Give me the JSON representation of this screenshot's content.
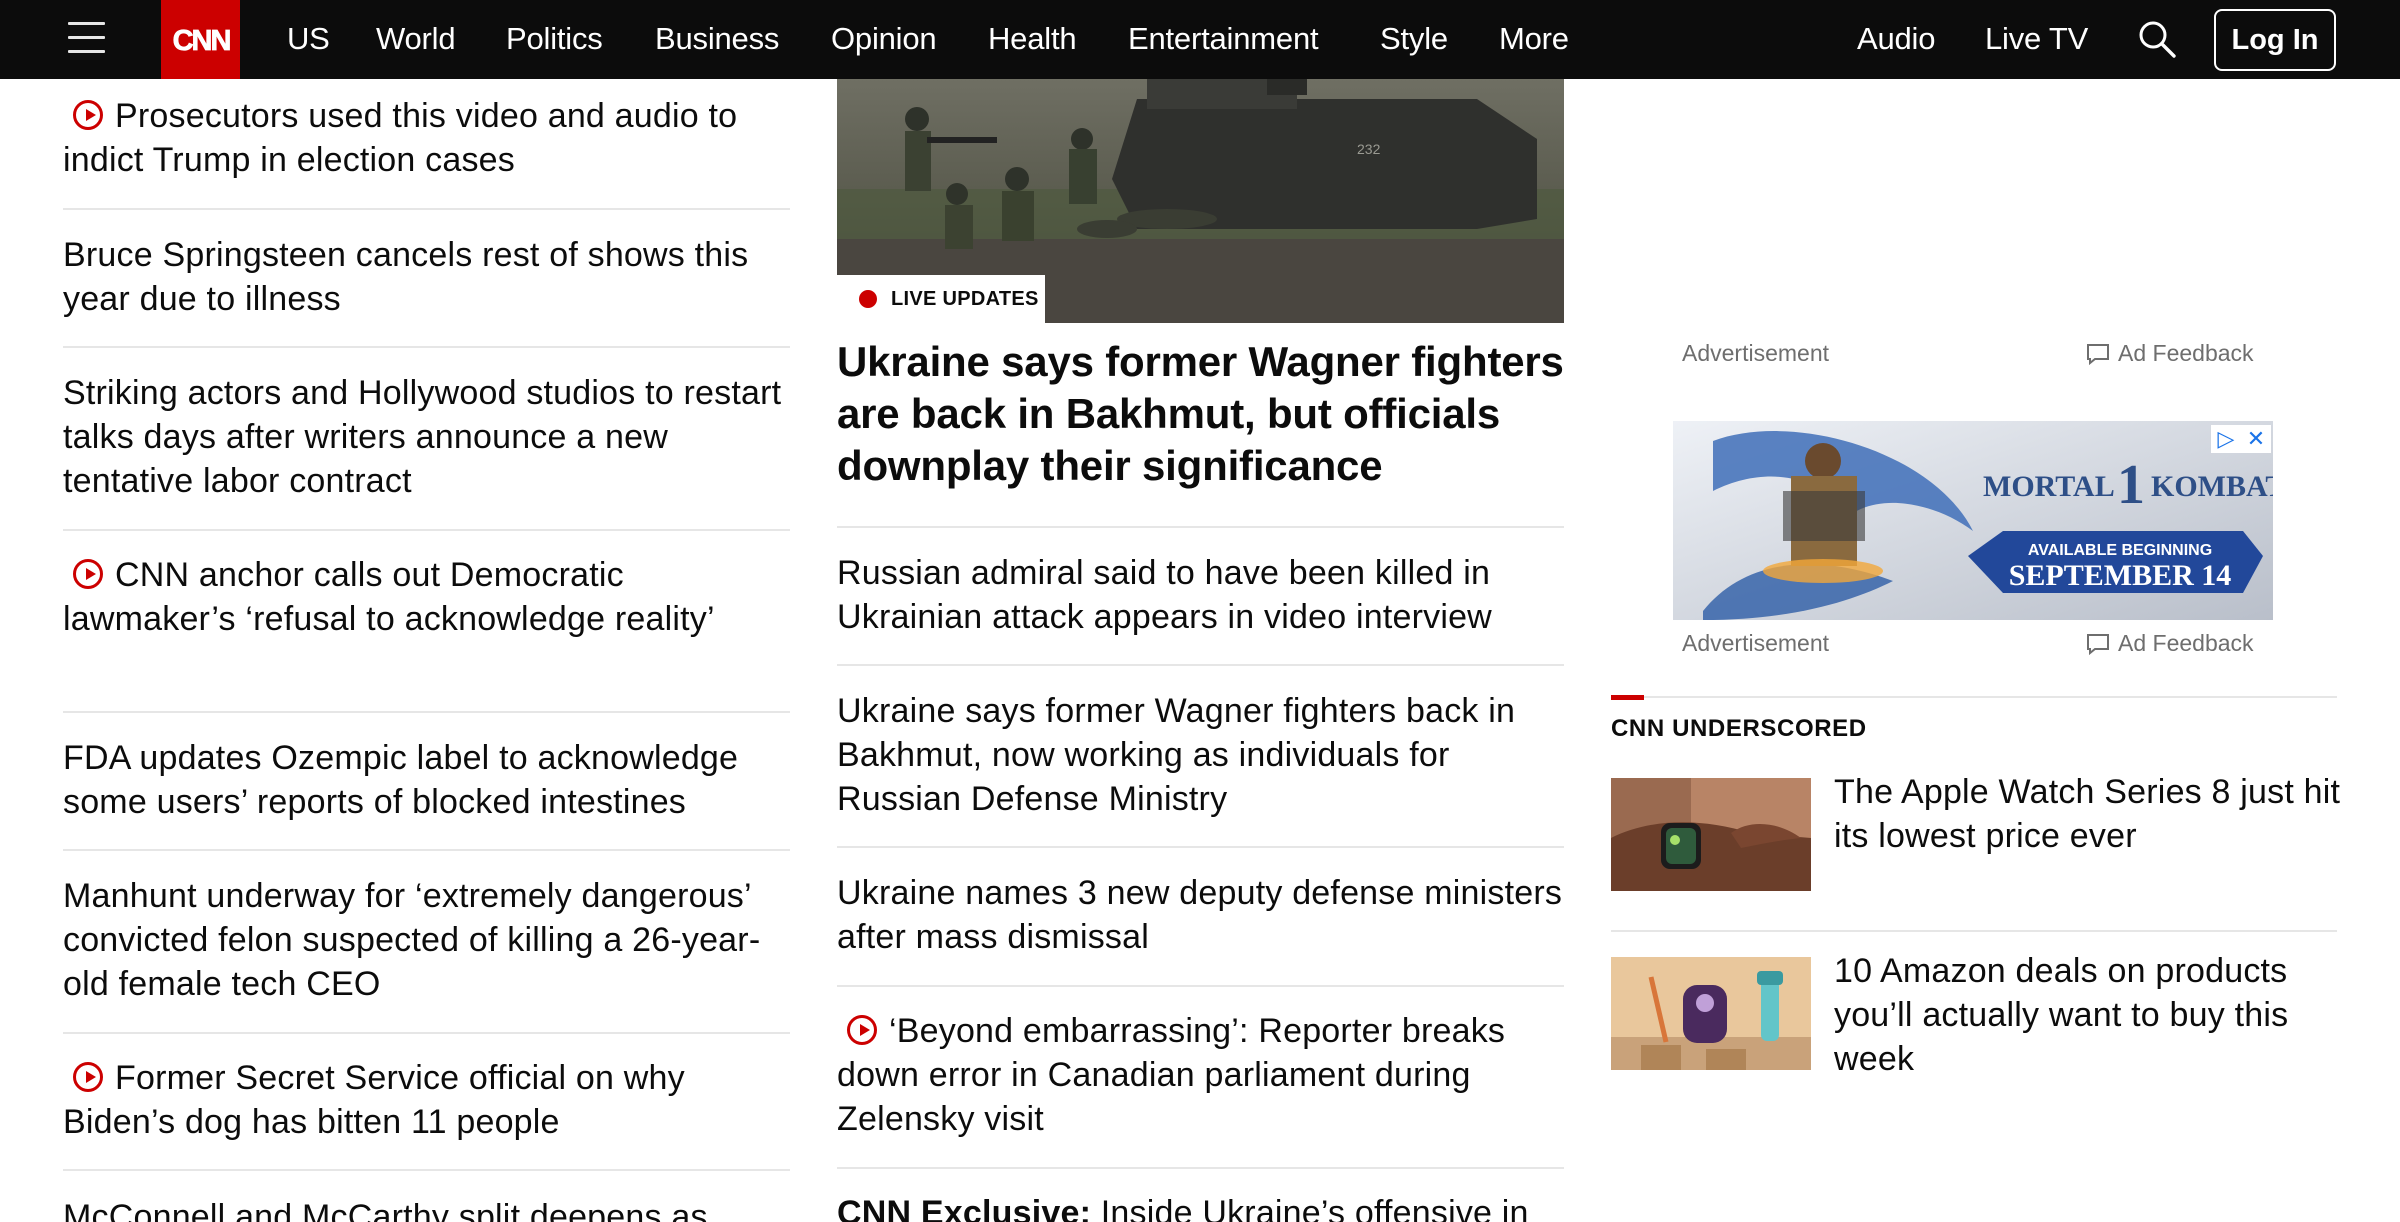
{
  "header": {
    "logo": "CNN",
    "nav": [
      "US",
      "World",
      "Politics",
      "Business",
      "Opinion",
      "Health",
      "Entertainment",
      "Style",
      "More"
    ],
    "right": {
      "audio": "Audio",
      "live_tv": "Live TV",
      "login": "Log In"
    },
    "colors": {
      "bar": "#0c0c0c",
      "brand": "#cc0000"
    }
  },
  "left_stories": [
    {
      "text": "Prosecutors used this video and audio to indict Trump in election cases",
      "video": true
    },
    {
      "text": "Bruce Springsteen cancels rest of shows this year due to illness",
      "video": false
    },
    {
      "text": "Striking actors and Hollywood studios to restart talks days after writers announce a new tentative labor contract",
      "video": false
    },
    {
      "text": "CNN anchor calls out Democratic lawmaker’s ‘refusal to acknowledge reality’",
      "video": true
    },
    {
      "text": "FDA updates Ozempic label to acknowledge some users’ reports of blocked intestines",
      "video": false
    },
    {
      "text": "Manhunt underway for ‘extremely dangerous’ convicted felon suspected of killing a 26-year-old female tech CEO",
      "video": false
    },
    {
      "text": "Former Secret Service official on why Biden’s dog has bitten 11 people",
      "video": true
    },
    {
      "text": "McConnell and McCarthy split deepens as",
      "video": false
    }
  ],
  "main": {
    "badge": "LIVE UPDATES",
    "hero_vehicle_marking": "232",
    "headline": "Ukraine says former Wagner fighters are back in Bakhmut, but officials downplay their significance",
    "stories": [
      {
        "text": "Russian admiral said to have been killed in Ukrainian attack appears in video interview",
        "video": false
      },
      {
        "text": "Ukraine says former Wagner fighters back in Bakhmut, now working as individuals for Russian Defense Ministry",
        "video": false
      },
      {
        "text": "Ukraine names 3 new deputy defense ministers after mass dismissal",
        "video": false
      },
      {
        "text": "‘Beyond embarrassing’: Reporter breaks down error in Canadian parliament during Zelensky visit",
        "video": true
      },
      {
        "prefix": "CNN Exclusive:",
        "text": " Inside Ukraine’s offensive in",
        "video": false
      }
    ]
  },
  "sidebar": {
    "ad1": {
      "label": "Advertisement",
      "feedback": "Ad Feedback"
    },
    "ad2": {
      "label": "Advertisement",
      "feedback": "Ad Feedback",
      "creative": {
        "title_left": "MORTAL",
        "numeral": "1",
        "title_right": "KOMBAT",
        "line1": "AVAILABLE BEGINNING",
        "line2": "SEPTEMBER 14"
      }
    },
    "underscored": {
      "title": "CNN UNDERSCORED",
      "items": [
        {
          "text": "The Apple Watch Series 8 just hit its lowest price ever",
          "thumb": "apple-watch"
        },
        {
          "text": "10 Amazon deals on products you’ll actually want to buy this week",
          "thumb": "amazon-products"
        }
      ]
    }
  }
}
